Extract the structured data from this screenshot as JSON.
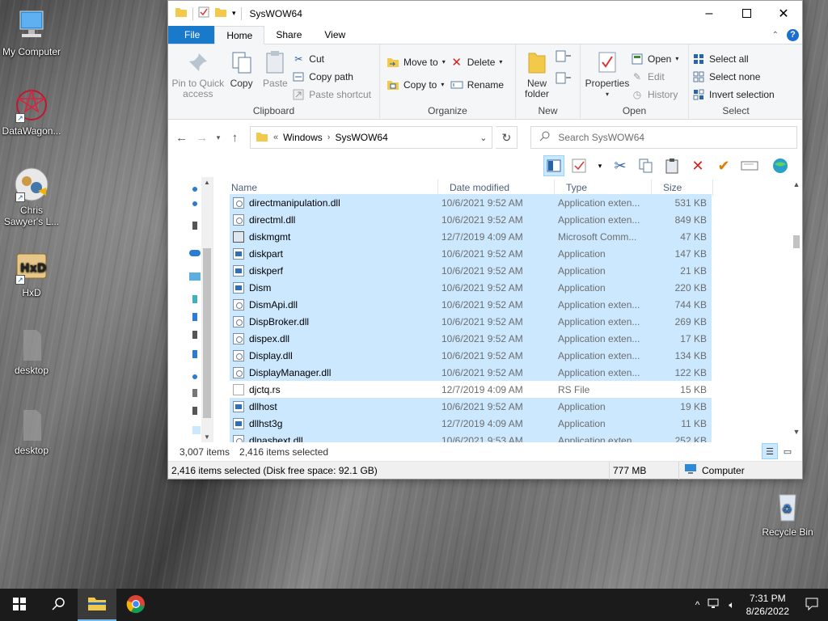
{
  "desktop": {
    "icons": [
      {
        "label": "My Computer"
      },
      {
        "label": "DataWagon..."
      },
      {
        "label": "Chris Sawyer's L..."
      },
      {
        "label": "HxD"
      },
      {
        "label": "desktop"
      },
      {
        "label": "desktop"
      },
      {
        "label": "Recycle Bin"
      }
    ]
  },
  "window": {
    "title": "SysWOW64",
    "tabs": {
      "file": "File",
      "home": "Home",
      "share": "Share",
      "view": "View"
    },
    "help": "?",
    "ribbon": {
      "clipboard": {
        "label": "Clipboard",
        "pin": "Pin to Quick access",
        "copy": "Copy",
        "paste": "Paste",
        "cut": "Cut",
        "copy_path": "Copy path",
        "paste_shortcut": "Paste shortcut"
      },
      "organize": {
        "label": "Organize",
        "move_to": "Move to",
        "copy_to": "Copy to",
        "delete": "Delete",
        "rename": "Rename"
      },
      "new": {
        "label": "New",
        "new_folder": "New folder"
      },
      "open": {
        "label": "Open",
        "properties": "Properties",
        "open": "Open",
        "edit": "Edit",
        "history": "History"
      },
      "select": {
        "label": "Select",
        "select_all": "Select all",
        "select_none": "Select none",
        "invert": "Invert selection"
      }
    },
    "address": {
      "prefix": "«",
      "crumbs": [
        "Windows",
        "SysWOW64"
      ],
      "search_placeholder": "Search SysWOW64"
    },
    "columns": {
      "name": "Name",
      "date": "Date modified",
      "type": "Type",
      "size": "Size"
    },
    "files": [
      {
        "name": "directmanipulation.dll",
        "date": "10/6/2021 9:52 AM",
        "type": "Application exten...",
        "size": "531 KB",
        "icon": "dll"
      },
      {
        "name": "directml.dll",
        "date": "10/6/2021 9:52 AM",
        "type": "Application exten...",
        "size": "849 KB",
        "icon": "dll"
      },
      {
        "name": "diskmgmt",
        "date": "12/7/2019 4:09 AM",
        "type": "Microsoft Comm...",
        "size": "47 KB",
        "icon": "msc"
      },
      {
        "name": "diskpart",
        "date": "10/6/2021 9:52 AM",
        "type": "Application",
        "size": "147 KB",
        "icon": "app"
      },
      {
        "name": "diskperf",
        "date": "10/6/2021 9:52 AM",
        "type": "Application",
        "size": "21 KB",
        "icon": "app"
      },
      {
        "name": "Dism",
        "date": "10/6/2021 9:52 AM",
        "type": "Application",
        "size": "220 KB",
        "icon": "app"
      },
      {
        "name": "DismApi.dll",
        "date": "10/6/2021 9:52 AM",
        "type": "Application exten...",
        "size": "744 KB",
        "icon": "dll"
      },
      {
        "name": "DispBroker.dll",
        "date": "10/6/2021 9:52 AM",
        "type": "Application exten...",
        "size": "269 KB",
        "icon": "dll"
      },
      {
        "name": "dispex.dll",
        "date": "10/6/2021 9:52 AM",
        "type": "Application exten...",
        "size": "17 KB",
        "icon": "dll"
      },
      {
        "name": "Display.dll",
        "date": "10/6/2021 9:52 AM",
        "type": "Application exten...",
        "size": "134 KB",
        "icon": "dll"
      },
      {
        "name": "DisplayManager.dll",
        "date": "10/6/2021 9:52 AM",
        "type": "Application exten...",
        "size": "122 KB",
        "icon": "dll"
      },
      {
        "name": "djctq.rs",
        "date": "12/7/2019 4:09 AM",
        "type": "RS File",
        "size": "15 KB",
        "icon": "rs"
      },
      {
        "name": "dllhost",
        "date": "10/6/2021 9:52 AM",
        "type": "Application",
        "size": "19 KB",
        "icon": "app"
      },
      {
        "name": "dllhst3g",
        "date": "12/7/2019 4:09 AM",
        "type": "Application",
        "size": "11 KB",
        "icon": "app"
      },
      {
        "name": "dlnashext.dll",
        "date": "10/6/2021 9:53 AM",
        "type": "Application exten...",
        "size": "252 KB",
        "icon": "dll"
      }
    ],
    "status": {
      "items": "3,007 items",
      "selected": "2,416 items selected"
    },
    "details": {
      "summary": "2,416 items selected (Disk free space: 92.1 GB)",
      "size": "777 MB",
      "location": "Computer"
    }
  },
  "taskbar": {
    "time": "7:31 PM",
    "date": "8/26/2022"
  },
  "colors": {
    "selection": "#cce8ff",
    "file_tab": "#1979ca",
    "taskbar": "#1b1b1b"
  }
}
